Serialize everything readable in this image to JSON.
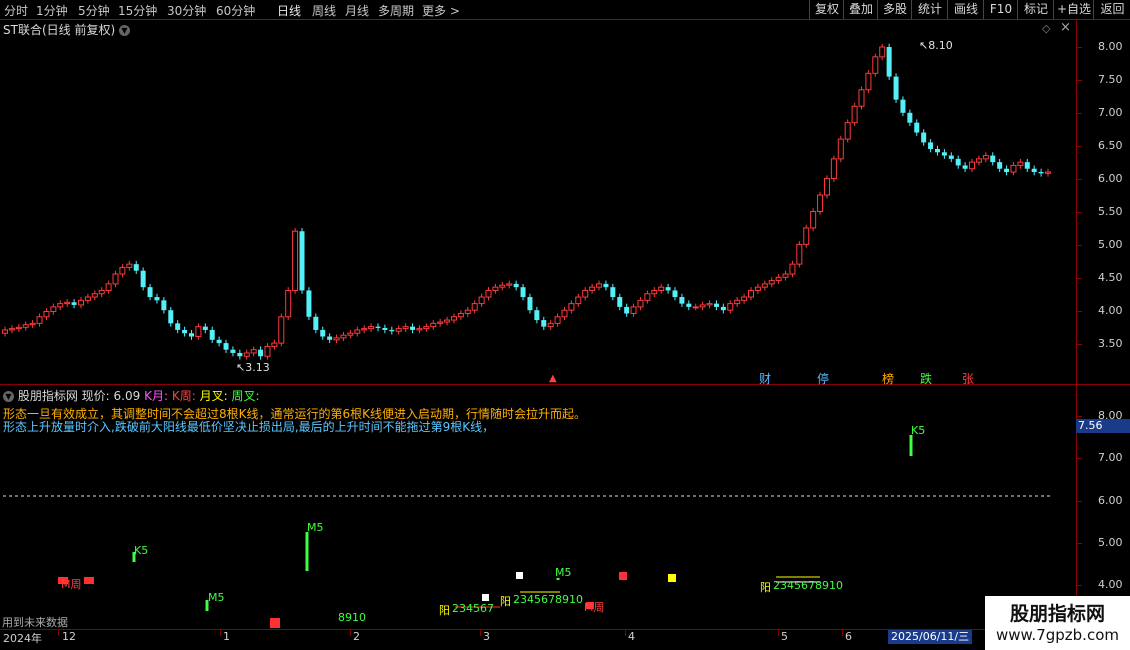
{
  "toolbar": {
    "periods": [
      "分时",
      "1分钟",
      "5分钟",
      "15分钟",
      "30分钟",
      "60分钟",
      "日线",
      "周线",
      "月线",
      "多周期",
      "更多 >"
    ],
    "active_period": "日线",
    "right_buttons": [
      "复权",
      "叠加",
      "多股",
      "统计",
      "画线",
      "F10",
      "标记",
      "+自选",
      "返回"
    ]
  },
  "main_chart": {
    "title": "ST联合(日线 前复权)",
    "y_ticks": [
      "8.00",
      "7.50",
      "7.00",
      "6.50",
      "6.00",
      "5.50",
      "5.00",
      "4.50",
      "4.00",
      "3.50"
    ],
    "high_label": "8.10",
    "low_label": "3.13",
    "event_tags": [
      {
        "text": "财",
        "color": "#56b8ff"
      },
      {
        "text": "停",
        "color": "#56b8ff"
      },
      {
        "text": "榜",
        "color": "#ffb000"
      },
      {
        "text": "跌",
        "color": "#40ff40"
      },
      {
        "text": "张",
        "color": "#ff4040"
      }
    ]
  },
  "indicator": {
    "name": "股朋指标网",
    "current_label": "现价: 6.09",
    "tags": [
      {
        "text": "K月:",
        "color": "#ff55ff"
      },
      {
        "text": "K周:",
        "color": "#ff4040"
      },
      {
        "text": "月叉:",
        "color": "#ffff00"
      },
      {
        "text": "周叉:",
        "color": "#40ff40"
      }
    ],
    "note1": "形态一旦有效成立，其调整时间不会超过8根K线，通常运行的第6根K线便进入启动期，行情随时会拉升而起。",
    "note2": "形态上升放量时介入,跌破前大阳线最低价坚决止损出局,最后的上升时间不能拖过第9根K线，",
    "y_ticks": [
      "8.00",
      "7.00",
      "6.00",
      "5.00",
      "4.00"
    ],
    "current_value": "7.56",
    "marks": [
      {
        "text": "K5",
        "color": "#40ff40"
      },
      {
        "text": "K5",
        "color": "#40ff40"
      },
      {
        "text": "M5",
        "color": "#40ff40"
      },
      {
        "text": "M5",
        "color": "#40ff40"
      },
      {
        "text": "M5",
        "color": "#40ff40"
      },
      {
        "text": "M周",
        "color": "#ff4040"
      },
      {
        "text": "M周",
        "color": "#ff4040"
      },
      {
        "text": "阳",
        "color": "#ffff00"
      },
      {
        "text": "234567",
        "color": "#40ff40"
      },
      {
        "text": "阳",
        "color": "#ffff00"
      },
      {
        "text": "2345678910",
        "color": "#40ff40"
      },
      {
        "text": "阳",
        "color": "#ffff00"
      },
      {
        "text": "2345678910",
        "color": "#40ff40"
      },
      {
        "text": "8910",
        "color": "#40ff40"
      }
    ],
    "footer_note": "用到未来数据"
  },
  "x_axis": {
    "labels": [
      "2024年",
      "12",
      "1",
      "2",
      "3",
      "4",
      "5",
      "6"
    ],
    "cursor_date": "2025/06/11/三"
  },
  "watermark": {
    "title": "股朋指标网",
    "url": "www.7gpzb.com"
  }
}
